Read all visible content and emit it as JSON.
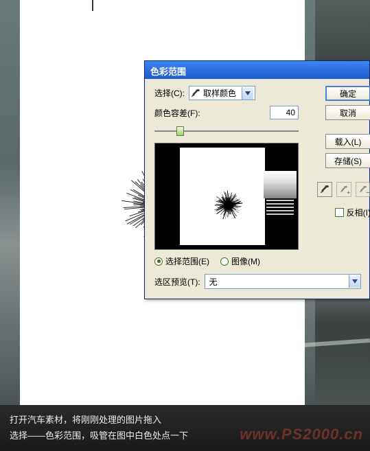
{
  "dialog": {
    "title": "色彩范围",
    "select_label": "选择(C):",
    "select_value": "取样颜色",
    "fuzziness_label": "颜色容差(F):",
    "fuzziness_value": "40",
    "radio_selection": "选择范围(E)",
    "radio_image": "图像(M)",
    "preview_label": "选区预览(T):",
    "preview_value": "无",
    "buttons": {
      "ok": "确定",
      "cancel": "取消",
      "load": "载入(L)",
      "save": "存储(S)"
    },
    "invert_label": "反相(I)"
  },
  "caption": {
    "line1": "打开汽车素材，将刚刚处理的图片拖入",
    "line2": "选择——色彩范围，吸管在图中白色处点一下"
  },
  "watermark": "www.PS2000.cn"
}
